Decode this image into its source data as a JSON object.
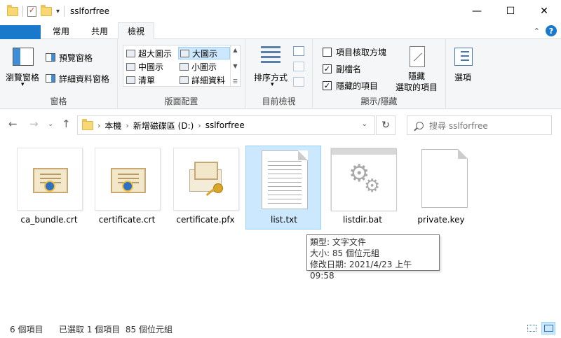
{
  "window": {
    "title": "sslforfree",
    "minimize": "—",
    "maximize": "☐",
    "close": "✕"
  },
  "tabs": {
    "file": "檔案",
    "home": "常用",
    "share": "共用",
    "view": "檢視"
  },
  "ribbon": {
    "pane": {
      "navigation_pane": "瀏覽窗格",
      "preview_pane": "預覽窗格",
      "details_pane": "詳細資料窗格",
      "label": "窗格"
    },
    "layout": {
      "items": [
        "超大圖示",
        "大圖示",
        "中圖示",
        "小圖示",
        "清單",
        "詳細資料"
      ],
      "selected": "大圖示",
      "label": "版面配置"
    },
    "current_view": {
      "sort_by": "排序方式",
      "label": "目前檢視"
    },
    "show_hide": {
      "item_checkboxes": "項目核取方塊",
      "item_checkboxes_checked": false,
      "file_extensions": "副檔名",
      "file_extensions_checked": true,
      "hidden_items": "隱藏的項目",
      "hidden_items_checked": true,
      "hide_selected_1": "隱藏",
      "hide_selected_2": "選取的項目",
      "label": "顯示/隱藏"
    },
    "options": {
      "label": "選項"
    }
  },
  "address": {
    "crumbs": [
      "本機",
      "新增磁碟區 (D:)",
      "sslforfree"
    ],
    "search_placeholder": "搜尋 sslforfree"
  },
  "files": [
    {
      "name": "ca_bundle.crt",
      "icon": "certificate-icon"
    },
    {
      "name": "certificate.crt",
      "icon": "certificate-icon"
    },
    {
      "name": "certificate.pfx",
      "icon": "pfx-icon"
    },
    {
      "name": "list.txt",
      "icon": "text-document-icon",
      "selected": true
    },
    {
      "name": "listdir.bat",
      "icon": "batch-file-icon"
    },
    {
      "name": "private.key",
      "icon": "blank-file-icon"
    }
  ],
  "tooltip": {
    "type": "類型: 文字文件",
    "size": "大小: 85 個位元組",
    "modified": "修改日期: 2021/4/23 上午 09:58"
  },
  "status": {
    "count": "6 個項目",
    "selection": "已選取 1 個項目  85 個位元組"
  },
  "colors": {
    "accent": "#1979ca",
    "selection": "#cce8ff",
    "selection_border": "#99d1ff"
  }
}
